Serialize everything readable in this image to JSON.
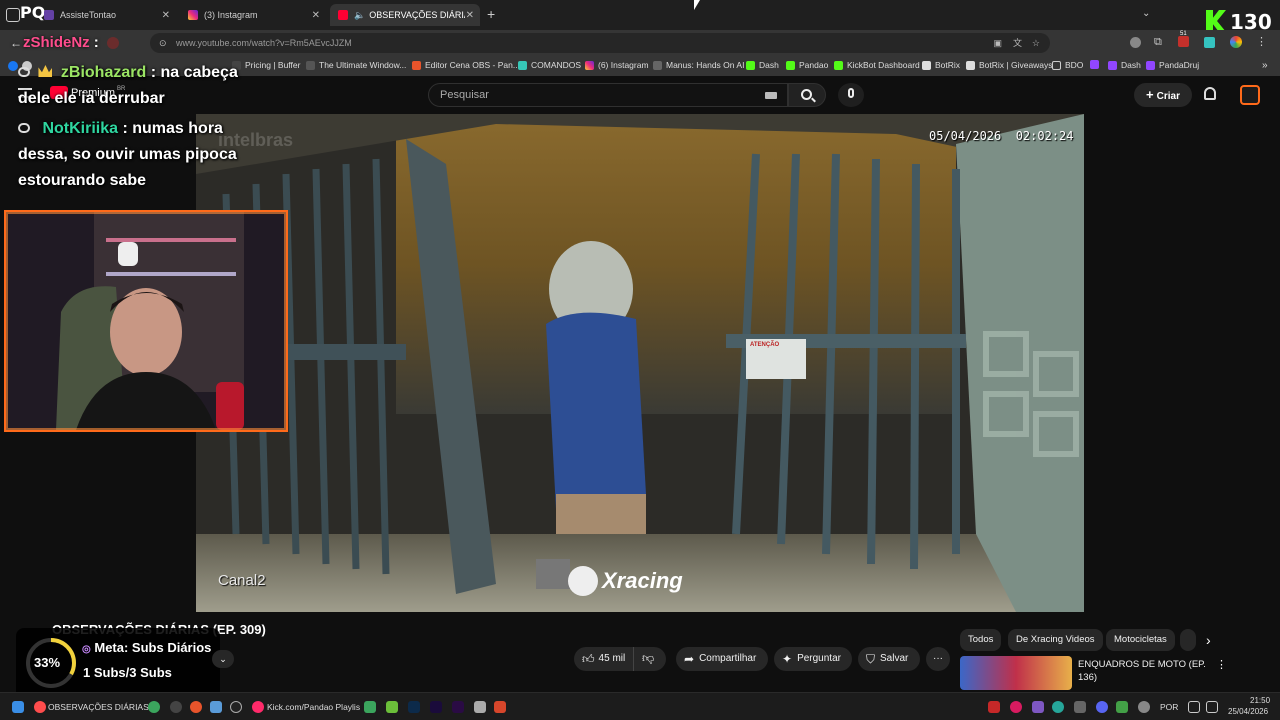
{
  "browser": {
    "tabs": [
      {
        "label": "AssisteTontao",
        "active": false
      },
      {
        "label": "(3) Instagram",
        "active": false
      },
      {
        "label": "OBSERVAÇÕES DIÁRIAS (EP",
        "active": true
      }
    ],
    "new_tab_label": "+",
    "url": "www.youtube.com/watch?v=Rm5AEvcJJZM",
    "bookmarks": [
      "Pricing | Buffer",
      "The Ultimate Window...",
      "Editor Cena OBS - Pan...",
      "COMANDOS",
      "(6) Instagram",
      "Manus: Hands On AI",
      "Dash",
      "Pandao",
      "KickBot Dashboard",
      "BotRix",
      "BotRix | Giveaways",
      "BDO",
      "Dash",
      "PandaDruj"
    ],
    "extension_badge": "51"
  },
  "youtube": {
    "logo_text": "Premium",
    "logo_region": "BR",
    "search_placeholder": "Pesquisar",
    "create_label": "Criar",
    "video_title": "OBSERVAÇÕES DIÁRIAS (EP. 309)",
    "actions": {
      "likes": "45 mil",
      "share": "Compartilhar",
      "ask": "Perguntar",
      "save": "Salvar"
    },
    "chips": [
      "Todos",
      "De Xracing Videos",
      "Motocicletas"
    ],
    "suggested": {
      "title": "ENQUADROS DE MOTO (EP. 136)"
    }
  },
  "video_overlay": {
    "timestamp": "05/04/2026  02:02:24",
    "channel_label": "Canal2",
    "brand": "Xracing",
    "sign_text": "ATENÇÃO",
    "camera_brand": "intelbras"
  },
  "stream_overlay": {
    "streamer": "zShideNz",
    "kick_count": "130",
    "chat": [
      {
        "user": "zBiohazard",
        "message": "na cabeça dele ele ia derrubar",
        "color": "#9be564"
      },
      {
        "user": "NotKiriika",
        "message": "numas hora dessa, so ouvir umas pipoca estourando sabe",
        "color": "#2fd6a0"
      }
    ],
    "goal": {
      "percent": 33,
      "percent_label": "33%",
      "title": "Meta: Subs Diários",
      "progress": "1 Subs/3 Subs"
    }
  },
  "taskbar": {
    "items": [
      "OBSERVAÇÕES DIÁRIAS",
      "Kick.com/Pandao Playlis"
    ],
    "language": "POR",
    "time": "21:50",
    "date": "25/04/2026"
  },
  "colors": {
    "kick_green": "#53fc18",
    "accent_orange": "#ff6a1a",
    "youtube_red": "#ff0033"
  }
}
